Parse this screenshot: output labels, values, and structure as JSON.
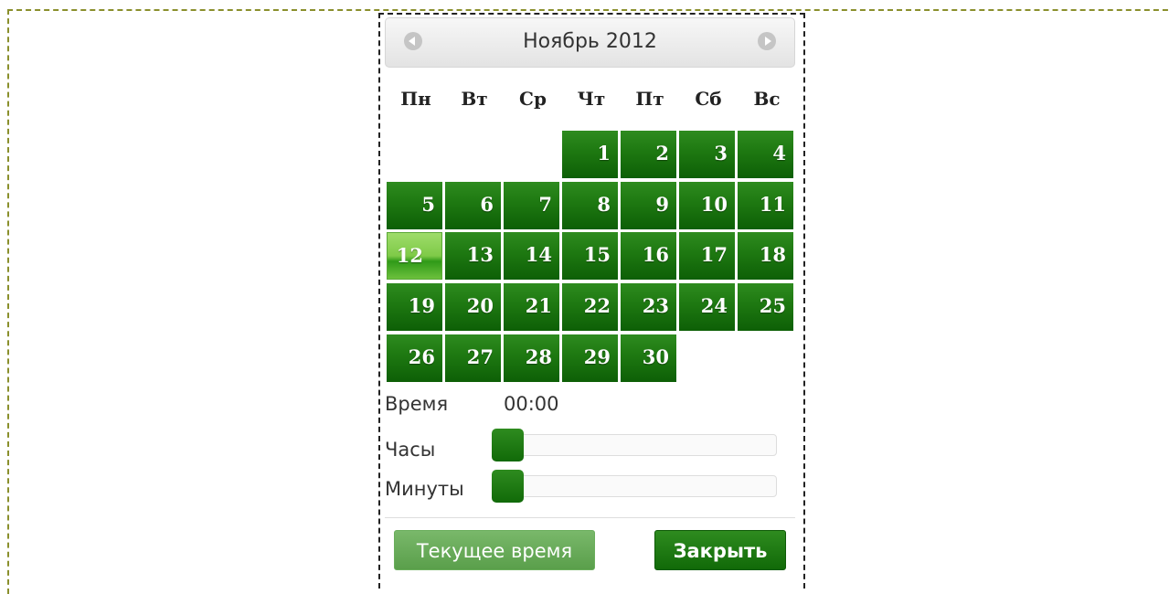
{
  "header": {
    "title": "Ноябрь 2012",
    "prev_icon": "circle-arrow-left-icon",
    "next_icon": "circle-arrow-right-icon"
  },
  "weekdays": [
    "Пн",
    "Вт",
    "Ср",
    "Чт",
    "Пт",
    "Сб",
    "Вс"
  ],
  "days": [
    "1",
    "2",
    "3",
    "4",
    "5",
    "6",
    "7",
    "8",
    "9",
    "10",
    "11",
    "12",
    "13",
    "14",
    "15",
    "16",
    "17",
    "18",
    "19",
    "20",
    "21",
    "22",
    "23",
    "24",
    "25",
    "26",
    "27",
    "28",
    "29",
    "30"
  ],
  "selected_day": "12",
  "time": {
    "label": "Время",
    "value": "00:00"
  },
  "hours": {
    "label": "Часы",
    "value": 0
  },
  "minutes": {
    "label": "Минуты",
    "value": 0
  },
  "buttons": {
    "now": "Текущее время",
    "close": "Закрыть"
  },
  "colors": {
    "accent": "#1f7a12",
    "selected": "#7fca48",
    "frame_dash": "#8a8f2c"
  }
}
